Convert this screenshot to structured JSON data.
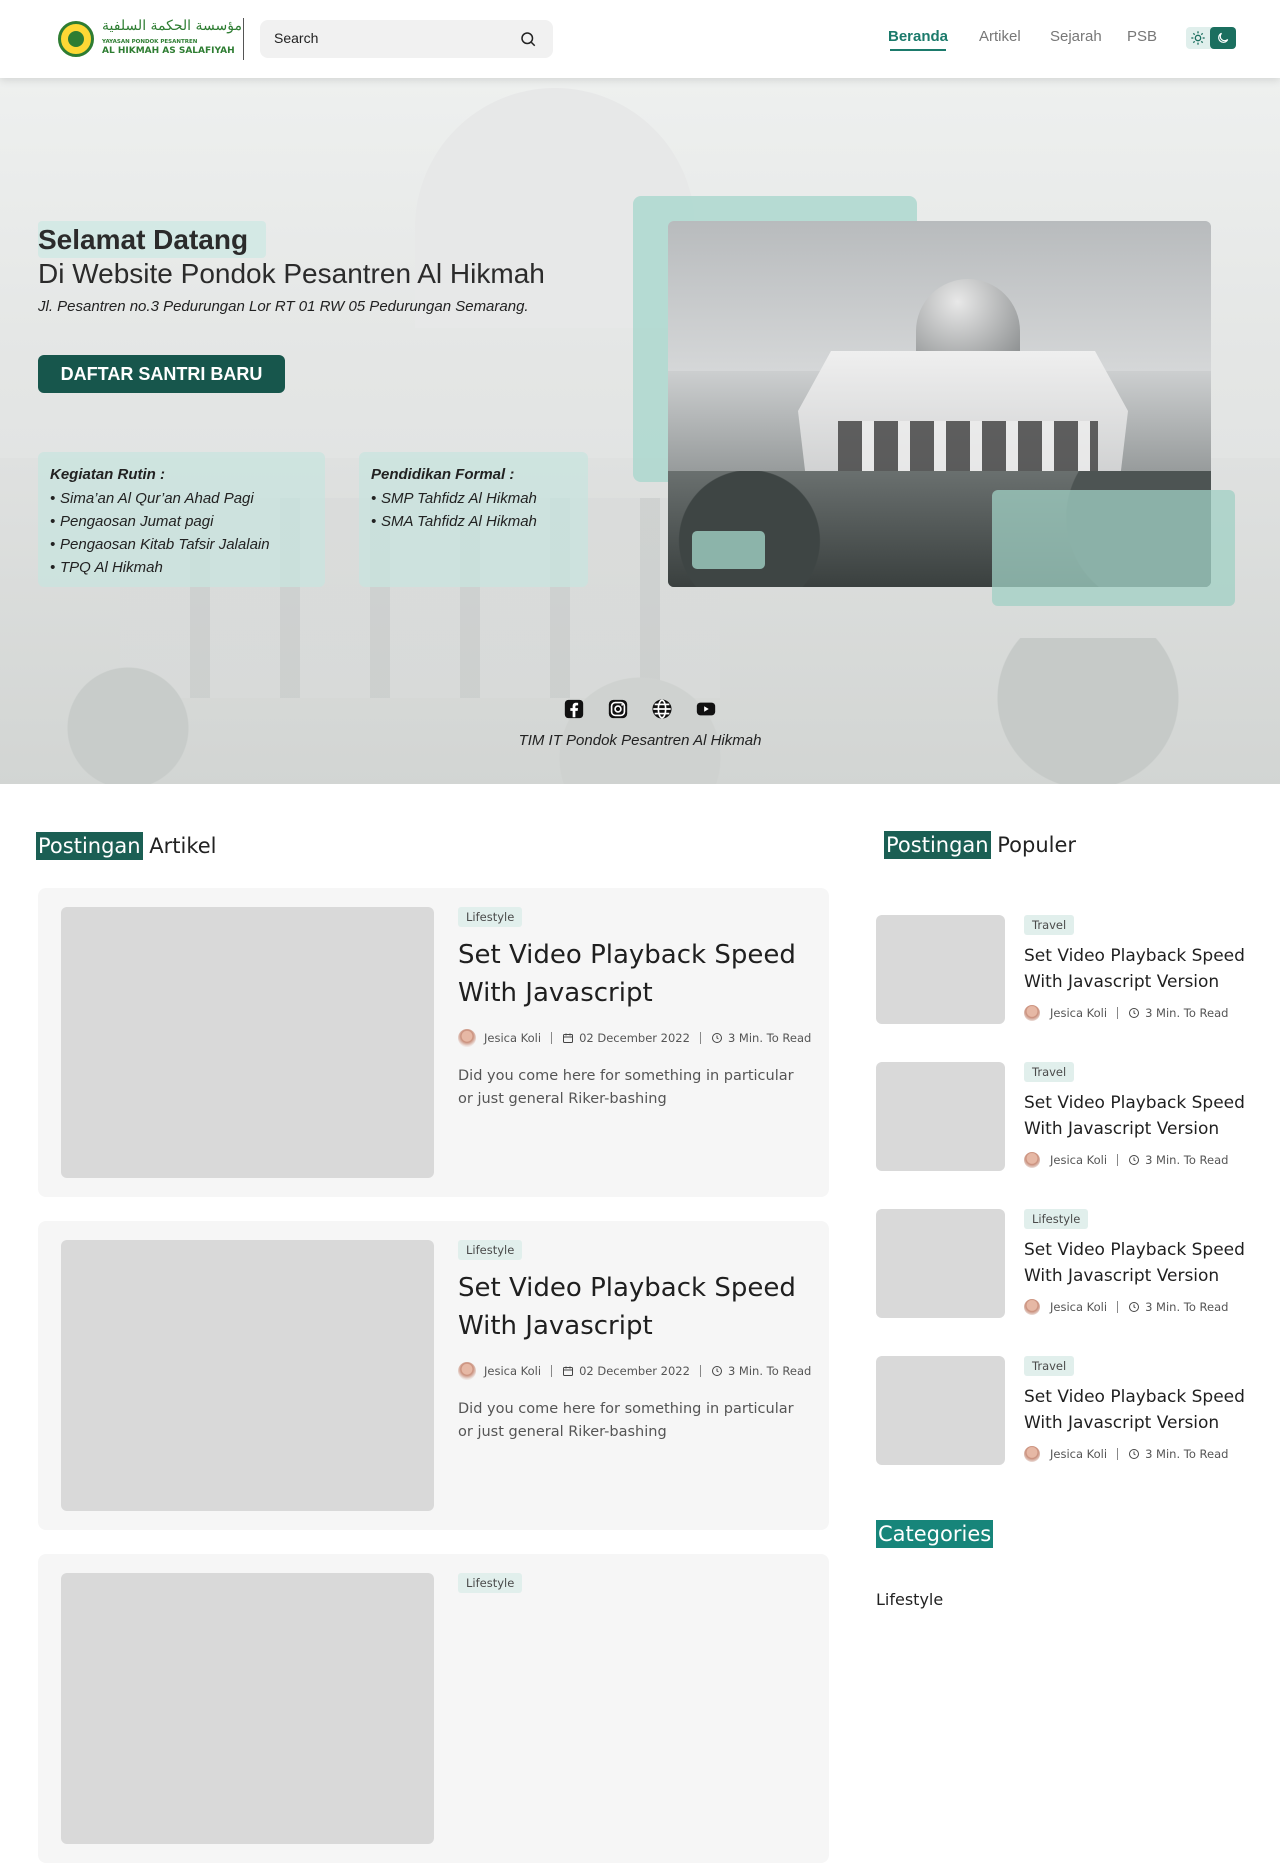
{
  "logo": {
    "arabic": "مؤسسة الحكمة السلفية",
    "small": "YAYASAN PONDOK PESANTREN",
    "big": "AL HIKMAH AS SALAFIYAH",
    "icon": "emblem-icon"
  },
  "search": {
    "placeholder": "Search",
    "icon": "search-icon"
  },
  "nav": {
    "items": [
      {
        "label": "Beranda",
        "active": true
      },
      {
        "label": "Artikel",
        "active": false
      },
      {
        "label": "Sejarah",
        "active": false
      },
      {
        "label": "PSB",
        "active": false
      }
    ],
    "theme_icons": [
      "sun-icon",
      "moon-icon"
    ]
  },
  "hero": {
    "welcome": "Selamat Datang",
    "title": "Di Website Pondok Pesantren Al Hikmah",
    "address": "Jl. Pesantren no.3 Pedurungan Lor RT 01 RW 05 Pedurungan Semarang.",
    "cta": "DAFTAR SANTRI BARU",
    "kegiatan": {
      "title": "Kegiatan Rutin :",
      "items": [
        "Sima’an Al Qur’an Ahad Pagi",
        "Pengaosan Jumat pagi",
        "Pengaosan Kitab Tafsir Jalalain",
        "TPQ Al Hikmah"
      ]
    },
    "pendidikan": {
      "title": "Pendidikan Formal  :",
      "items": [
        "SMP Tahfidz Al Hikmah",
        "SMA Tahfidz Al Hikmah"
      ]
    },
    "social_icons": [
      "facebook-icon",
      "instagram-icon",
      "globe-icon",
      "youtube-icon"
    ],
    "footer": "TIM IT Pondok Pesantren Al Hikmah"
  },
  "articles": {
    "title_hl": "Postingan",
    "title_rest": " Artikel",
    "posts": [
      {
        "tag": "Lifestyle",
        "title": "Set Video Playback Speed With Javascript",
        "author": "Jesica Koli",
        "date": "02 December 2022",
        "read": "3 Min. To Read",
        "excerpt": "Did you come here for something in particular or just general Riker-bashing"
      },
      {
        "tag": "Lifestyle",
        "title": "Set Video Playback Speed With Javascript",
        "author": "Jesica Koli",
        "date": "02 December 2022",
        "read": "3 Min. To Read",
        "excerpt": "Did you come here for something in particular or just general Riker-bashing"
      },
      {
        "tag": "Lifestyle"
      }
    ]
  },
  "popular": {
    "title_hl": "Postingan",
    "title_rest": " Populer",
    "posts": [
      {
        "tag": "Travel",
        "title": "Set Video Playback Speed With Javascript Version",
        "author": "Jesica Koli",
        "read": "3 Min. To Read"
      },
      {
        "tag": "Travel",
        "title": "Set Video Playback Speed With Javascript Version",
        "author": "Jesica Koli",
        "read": "3 Min. To Read"
      },
      {
        "tag": "Lifestyle",
        "title": "Set Video Playback Speed With Javascript Version",
        "author": "Jesica Koli",
        "read": "3 Min. To Read"
      },
      {
        "tag": "Travel",
        "title": "Set Video Playback Speed With Javascript Version",
        "author": "Jesica Koli",
        "read": "3 Min. To Read"
      }
    ]
  },
  "categories": {
    "title": "Categories",
    "first": "Lifestyle"
  },
  "colors": {
    "accent": "#17564c",
    "accent_light": "#d4e9e5",
    "nav_active": "#1b7a6b"
  }
}
